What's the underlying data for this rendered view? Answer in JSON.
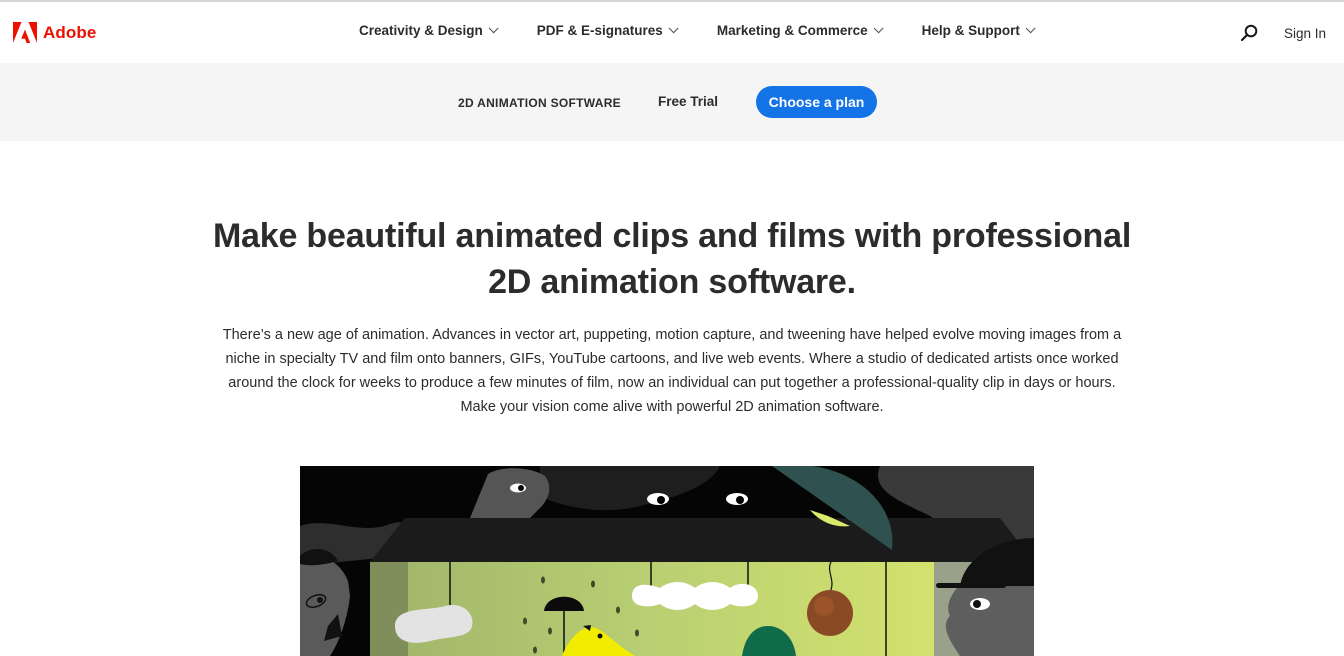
{
  "global_nav": {
    "brand": "Adobe",
    "brand_color": "#eb1000",
    "menu": [
      {
        "label": "Creativity & Design",
        "icon": "chevron-down-icon"
      },
      {
        "label": "PDF & E-signatures",
        "icon": "chevron-down-icon"
      },
      {
        "label": "Marketing & Commerce",
        "icon": "chevron-down-icon"
      },
      {
        "label": "Help & Support",
        "icon": "chevron-down-icon"
      }
    ],
    "search_icon": "search-icon",
    "sign_in": "Sign In"
  },
  "local_nav": {
    "title": "2D ANIMATION SOFTWARE",
    "free_trial": "Free Trial",
    "cta": "Choose a plan",
    "cta_color": "#1473e6"
  },
  "hero": {
    "title_line1": "Make beautiful animated clips and films with professional",
    "title_line2": "2D animation software.",
    "body": "There’s a new age of animation. Advances in vector art, puppeting, motion capture, and tweening have helped evolve moving images from a niche in specialty TV and film onto banners, GIFs, YouTube cartoons, and live web events. Where a studio of dedicated artists once worked around the clock for weeks to produce a few minutes of film, now an individual can put together a professional-quality clip in days or hours. Make your vision come alive with powerful 2D animation software."
  },
  "illustration": {
    "description": "Stylized animation illustration: onlookers peering into a green stage with hanging clouds, umbrella, yellow bird, and pendulum ball"
  }
}
